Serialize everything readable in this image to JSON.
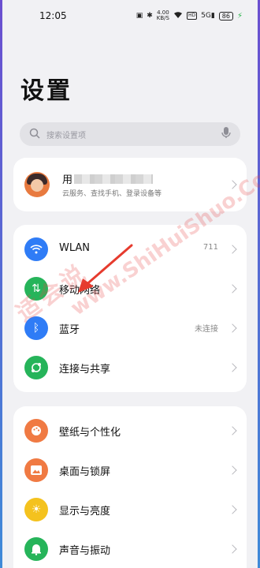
{
  "status": {
    "time": "12:05",
    "speed_top": "4.00",
    "speed_bottom": "KB/S",
    "hd": "HD",
    "network": "5G",
    "battery": "86"
  },
  "page": {
    "title": "设置"
  },
  "search": {
    "placeholder": "搜索设置项"
  },
  "account": {
    "name": "用",
    "subtitle": "云服务、查找手机、登录设备等"
  },
  "network_section": {
    "items": [
      {
        "label": "WLAN",
        "value": "711",
        "icon": "wifi-icon",
        "color": "#2f7cf6"
      },
      {
        "label": "移动网络",
        "value": "",
        "icon": "mobile-data-icon",
        "color": "#26b45a"
      },
      {
        "label": "蓝牙",
        "value": "未连接",
        "icon": "bluetooth-icon",
        "color": "#2f7cf6"
      },
      {
        "label": "连接与共享",
        "value": "",
        "icon": "share-icon",
        "color": "#26b45a"
      }
    ]
  },
  "display_section": {
    "items": [
      {
        "label": "壁纸与个性化",
        "icon": "palette-icon",
        "color": "#f07a43"
      },
      {
        "label": "桌面与锁屏",
        "icon": "image-icon",
        "color": "#f07a43"
      },
      {
        "label": "显示与亮度",
        "icon": "sun-icon",
        "color": "#f4c21e"
      },
      {
        "label": "声音与振动",
        "icon": "bell-icon",
        "color": "#26b45a"
      }
    ]
  },
  "watermark": {
    "cn": "适会说",
    "en": "www.ShiHuiShuo.Com"
  }
}
